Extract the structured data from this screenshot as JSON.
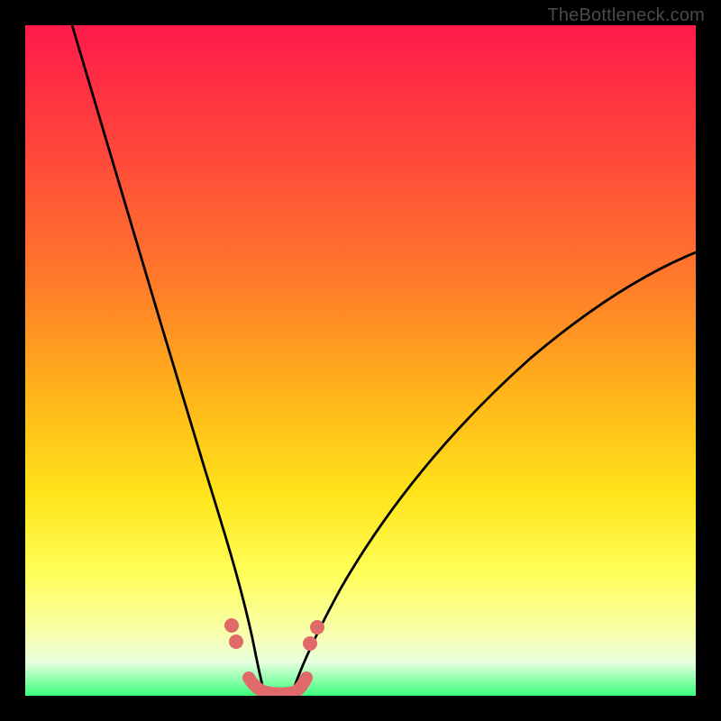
{
  "watermark": "TheBottleneck.com",
  "chart_data": {
    "type": "line",
    "title": "",
    "xlabel": "",
    "ylabel": "",
    "xlim": [
      0,
      100
    ],
    "ylim": [
      0,
      100
    ],
    "grid": false,
    "background_gradient": [
      "#ff1a4a",
      "#ff7a2a",
      "#ffe41a",
      "#ffff5a",
      "#3aff7a"
    ],
    "series": [
      {
        "name": "left-curve",
        "x": [
          7,
          10,
          15,
          20,
          25,
          28,
          30,
          32,
          33.5
        ],
        "y": [
          100,
          85,
          62,
          42,
          24,
          14,
          8,
          3,
          0.5
        ],
        "stroke": "#000000"
      },
      {
        "name": "right-curve",
        "x": [
          40,
          42,
          45,
          50,
          60,
          70,
          80,
          90,
          100
        ],
        "y": [
          0.5,
          3,
          8,
          15,
          28,
          40,
          50,
          58,
          66
        ],
        "stroke": "#000000"
      },
      {
        "name": "valley-floor",
        "x": [
          33.5,
          35,
          37,
          39,
          40
        ],
        "y": [
          0.5,
          0.2,
          0.2,
          0.2,
          0.5
        ],
        "stroke": "#e56a6a"
      }
    ],
    "markers": [
      {
        "x": 30.5,
        "y": 11,
        "color": "#e06868"
      },
      {
        "x": 31.2,
        "y": 8.5,
        "color": "#e06868"
      },
      {
        "x": 41.5,
        "y": 7,
        "color": "#e06868"
      },
      {
        "x": 43,
        "y": 10,
        "color": "#e06868"
      },
      {
        "x": 33.5,
        "y": 1.5,
        "color": "#e06868"
      },
      {
        "x": 35,
        "y": 0.8,
        "color": "#e06868"
      },
      {
        "x": 36.5,
        "y": 0.6,
        "color": "#e06868"
      },
      {
        "x": 38,
        "y": 0.8,
        "color": "#e06868"
      },
      {
        "x": 39.5,
        "y": 1.5,
        "color": "#e06868"
      }
    ]
  }
}
